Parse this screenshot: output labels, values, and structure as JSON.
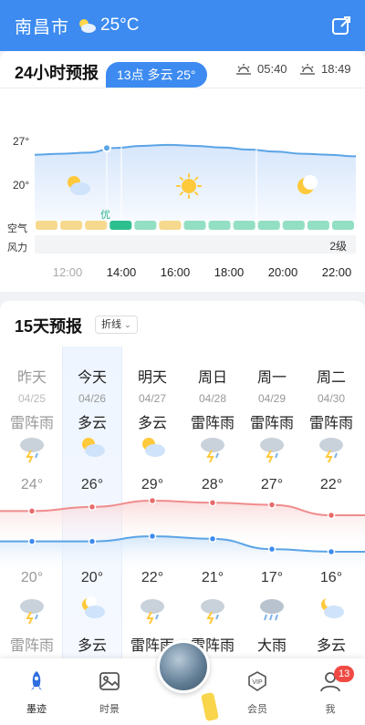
{
  "header": {
    "city": "南昌市",
    "weather_icon": "partly-cloudy-icon",
    "temperature": "25°C",
    "share_icon": "share-icon"
  },
  "forecast_24h": {
    "title": "24小时预报",
    "sunrise": "05:40",
    "sunset": "18:49",
    "y_ticks": [
      "27°",
      "20°"
    ],
    "tooltip": "13点 多云 25°",
    "air_label": "空气",
    "air_quality_tag": "优",
    "wind_label": "风力",
    "wind_level": "2级",
    "hours": [
      "12:00",
      "14:00",
      "16:00",
      "18:00",
      "20:00",
      "22:00"
    ],
    "temp_curve": [
      24.6,
      24.8,
      25.0,
      25.9,
      26.3,
      26.5,
      26.3,
      26.0,
      25.6,
      25.2,
      24.8,
      24.6,
      24.3
    ],
    "air_colors": [
      "#f6d98e",
      "#f6d98e",
      "#f6d98e",
      "#2dbf8e",
      "#93dfc4",
      "#f6d98e",
      "#93dfc4",
      "#93dfc4",
      "#93dfc4",
      "#93dfc4",
      "#93dfc4",
      "#93dfc4",
      "#93dfc4"
    ],
    "period_icons": [
      "partly-cloudy-icon",
      "sun-icon",
      "moon-icon"
    ]
  },
  "forecast_15d": {
    "title": "15天预报",
    "mode_label": "折线",
    "days": [
      {
        "name": "昨天",
        "date": "04/25",
        "day_cond": "雷阵雨",
        "day_icon": "thunderstorm-icon",
        "high": "24°",
        "low": "20°",
        "night_icon": "thunderstorm-icon",
        "night_cond": "雷阵雨",
        "past": true
      },
      {
        "name": "今天",
        "date": "04/26",
        "day_cond": "多云",
        "day_icon": "partly-cloudy-icon",
        "high": "26°",
        "low": "20°",
        "night_icon": "partly-cloudy-night-icon",
        "night_cond": "多云",
        "past": false
      },
      {
        "name": "明天",
        "date": "04/27",
        "day_cond": "多云",
        "day_icon": "partly-cloudy-icon",
        "high": "29°",
        "low": "22°",
        "night_icon": "thunderstorm-icon",
        "night_cond": "雷阵雨",
        "past": false
      },
      {
        "name": "周日",
        "date": "04/28",
        "day_cond": "雷阵雨",
        "day_icon": "thunderstorm-icon",
        "high": "28°",
        "low": "21°",
        "night_icon": "thunderstorm-icon",
        "night_cond": "雷阵雨",
        "past": false
      },
      {
        "name": "周一",
        "date": "04/29",
        "day_cond": "雷阵雨",
        "day_icon": "thunderstorm-icon",
        "high": "27°",
        "low": "17°",
        "night_icon": "heavy-rain-icon",
        "night_cond": "大雨",
        "past": false
      },
      {
        "name": "周二",
        "date": "04/30",
        "day_cond": "雷阵雨",
        "day_icon": "thunderstorm-icon",
        "high": "22°",
        "low": "16°",
        "night_icon": "partly-cloudy-night-icon",
        "night_cond": "多云",
        "past": false
      }
    ],
    "high_values": [
      24,
      26,
      29,
      28,
      27,
      22
    ],
    "low_values": [
      20,
      20,
      22,
      21,
      17,
      16
    ]
  },
  "tabbar": {
    "tabs": [
      {
        "label": "墨迹",
        "icon": "rocket-icon"
      },
      {
        "label": "时景",
        "icon": "photo-icon"
      },
      {
        "label": "会员",
        "icon": "vip-icon"
      },
      {
        "label": "我",
        "icon": "user-icon"
      }
    ],
    "badge_count": "13"
  },
  "colors": {
    "primary": "#3d8bf0",
    "high_line": "#f08c8c",
    "low_line": "#5ba4e6",
    "good_air": "#2dbf8e"
  }
}
